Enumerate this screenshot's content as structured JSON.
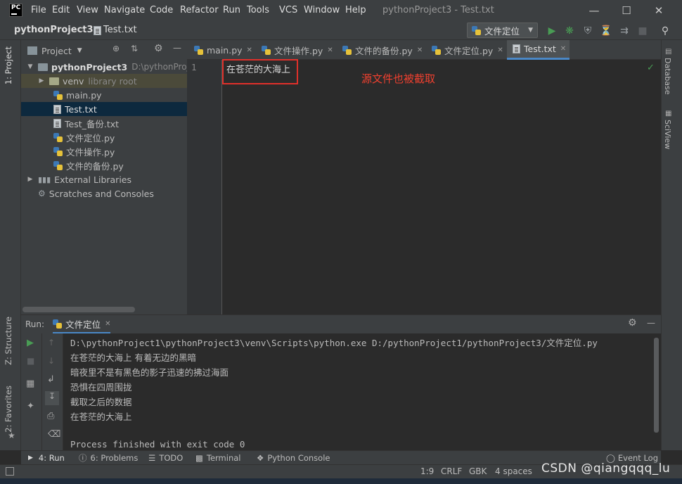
{
  "menu": {
    "items": [
      "File",
      "Edit",
      "View",
      "Navigate",
      "Code",
      "Refactor",
      "Run",
      "Tools",
      "VCS",
      "Window",
      "Help"
    ]
  },
  "window": {
    "title": "pythonProject3 - Test.txt",
    "logo": "PC"
  },
  "breadcrumb": {
    "project": "pythonProject3",
    "file": "Test.txt"
  },
  "run_config": {
    "label": "文件定位"
  },
  "left_tools": {
    "project_tab": "1: Project",
    "structure_tab": "Z: Structure",
    "favorites_tab": "2: Favorites"
  },
  "right_tools": {
    "database": "Database",
    "sciview": "SciView"
  },
  "project_panel": {
    "header": "Project",
    "root": {
      "name": "pythonProject3",
      "path": "D:\\pythonProjec"
    },
    "venv": {
      "name": "venv",
      "hint": "library root"
    },
    "files": [
      "main.py",
      "Test.txt",
      "Test_备份.txt",
      "文件定位.py",
      "文件操作.py",
      "文件的备份.py"
    ],
    "external": "External Libraries",
    "scratches": "Scratches and Consoles"
  },
  "editor": {
    "tabs": [
      "main.py",
      "文件操作.py",
      "文件的备份.py",
      "文件定位.py",
      "Test.txt"
    ],
    "active_tab": "Test.txt",
    "line_number": "1",
    "code_line": "在苍茫的大海上",
    "annotation": "源文件也被截取"
  },
  "run": {
    "label": "Run:",
    "tab": "文件定位",
    "output": [
      "D:\\pythonProject1\\pythonProject3\\venv\\Scripts\\python.exe D:/pythonProject1/pythonProject3/文件定位.py",
      "在苍茫的大海上 有着无边的黑暗",
      "暗夜里不是有黑色的影子迅速的拂过海面",
      "恐惧在四周围拢",
      "截取之后的数据",
      "在苍茫的大海上",
      "",
      "Process finished with exit code 0"
    ]
  },
  "bottom_tabs": {
    "run": "4: Run",
    "problems": "6: Problems",
    "todo": "TODO",
    "terminal": "Terminal",
    "python_console": "Python Console",
    "event_log": "Event Log"
  },
  "status": {
    "position": "1:9",
    "line_sep": "CRLF",
    "encoding": "GBK",
    "indent": "4 spaces"
  },
  "watermark": "CSDN @qiangqqq_lu",
  "colors": {
    "accent": "#4a88c7",
    "annotation": "#f0402f",
    "run_green": "#499c54"
  }
}
